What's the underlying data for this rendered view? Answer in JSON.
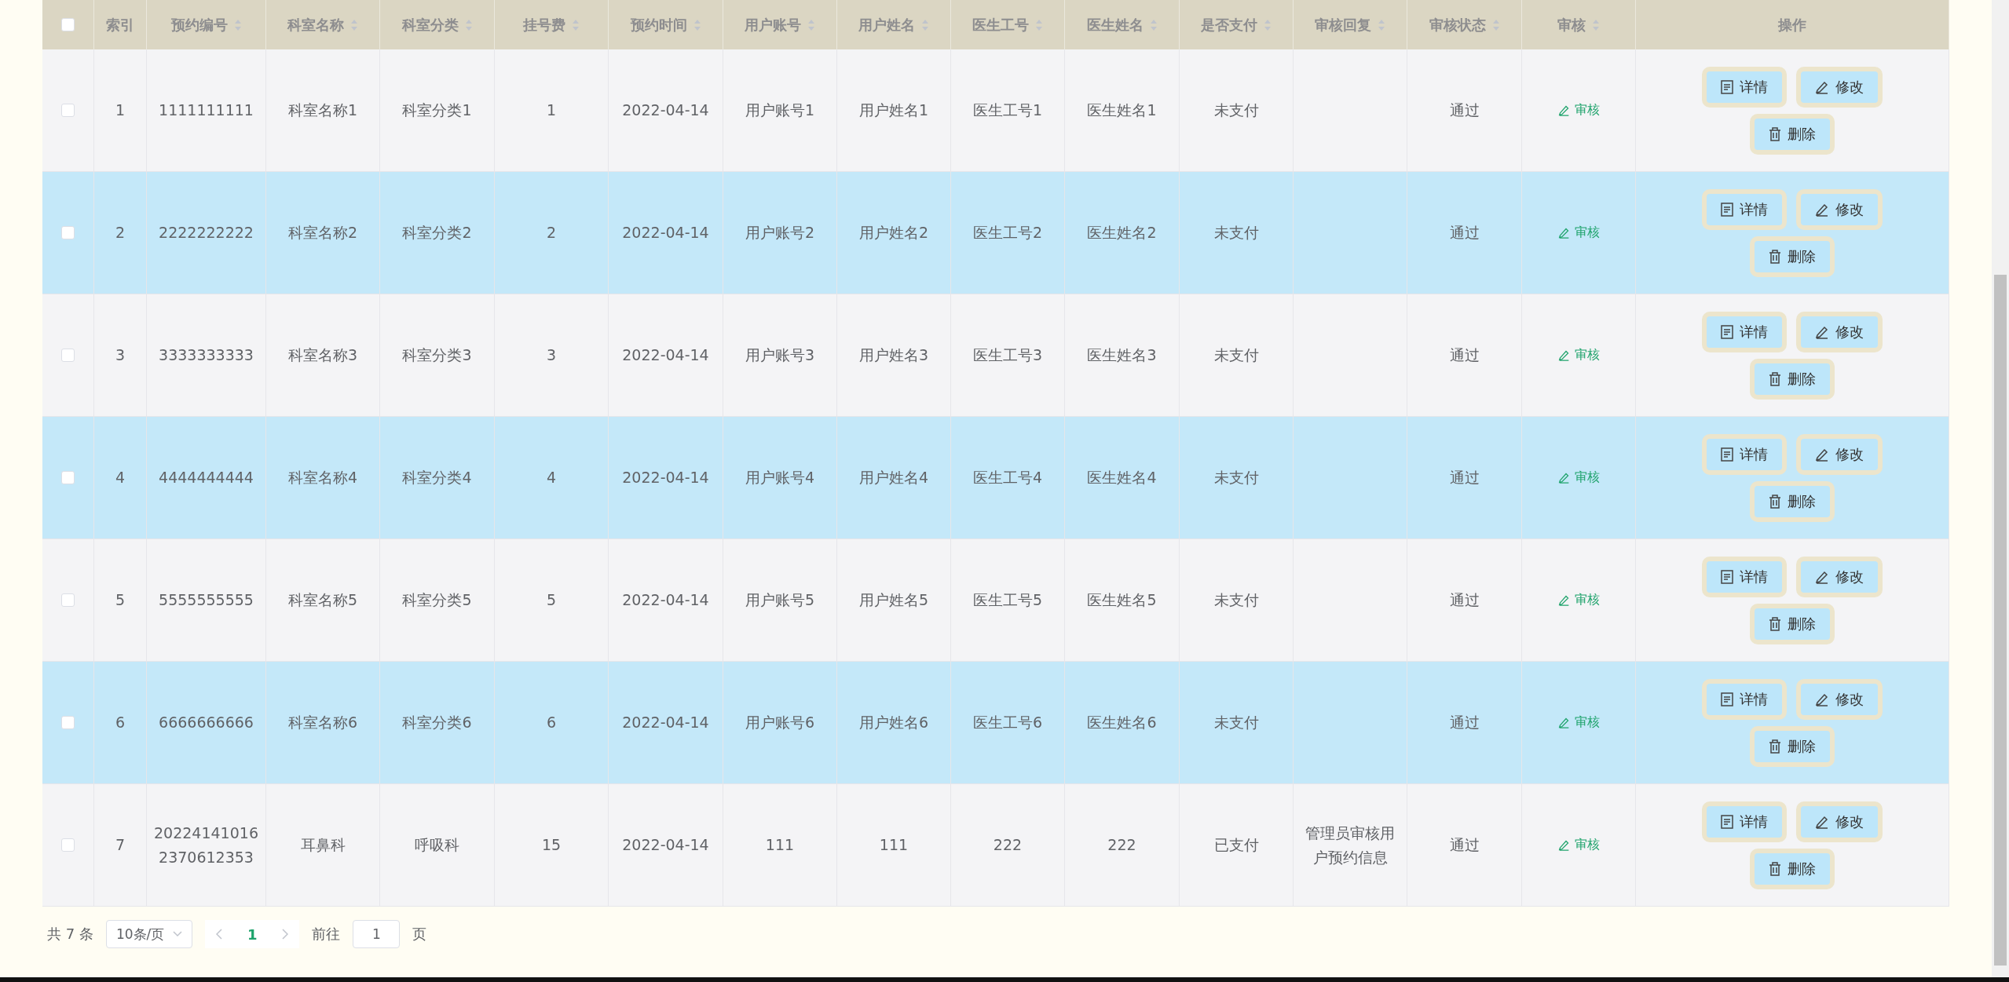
{
  "table": {
    "select_all": {
      "checked": false
    },
    "columns": [
      {
        "label": "索引",
        "sortable": false
      },
      {
        "label": "预约编号",
        "sortable": true
      },
      {
        "label": "科室名称",
        "sortable": true
      },
      {
        "label": "科室分类",
        "sortable": true
      },
      {
        "label": "挂号费",
        "sortable": true
      },
      {
        "label": "预约时间",
        "sortable": true
      },
      {
        "label": "用户账号",
        "sortable": true
      },
      {
        "label": "用户姓名",
        "sortable": true
      },
      {
        "label": "医生工号",
        "sortable": true
      },
      {
        "label": "医生姓名",
        "sortable": true
      },
      {
        "label": "是否支付",
        "sortable": true
      },
      {
        "label": "审核回复",
        "sortable": true
      },
      {
        "label": "审核状态",
        "sortable": true
      },
      {
        "label": "审核",
        "sortable": true
      },
      {
        "label": "操作",
        "sortable": false
      }
    ],
    "rows": [
      {
        "checked": false,
        "cells": [
          "1",
          "1111111111",
          "科室名称1",
          "科室分类1",
          "1",
          "2022-04-14",
          "用户账号1",
          "用户姓名1",
          "医生工号1",
          "医生姓名1",
          "未支付",
          "",
          "通过"
        ],
        "review_link": "审核",
        "actions": [
          "详情",
          "修改",
          "删除"
        ]
      },
      {
        "checked": false,
        "cells": [
          "2",
          "2222222222",
          "科室名称2",
          "科室分类2",
          "2",
          "2022-04-14",
          "用户账号2",
          "用户姓名2",
          "医生工号2",
          "医生姓名2",
          "未支付",
          "",
          "通过"
        ],
        "review_link": "审核",
        "actions": [
          "详情",
          "修改",
          "删除"
        ]
      },
      {
        "checked": false,
        "cells": [
          "3",
          "3333333333",
          "科室名称3",
          "科室分类3",
          "3",
          "2022-04-14",
          "用户账号3",
          "用户姓名3",
          "医生工号3",
          "医生姓名3",
          "未支付",
          "",
          "通过"
        ],
        "review_link": "审核",
        "actions": [
          "详情",
          "修改",
          "删除"
        ]
      },
      {
        "checked": false,
        "cells": [
          "4",
          "4444444444",
          "科室名称4",
          "科室分类4",
          "4",
          "2022-04-14",
          "用户账号4",
          "用户姓名4",
          "医生工号4",
          "医生姓名4",
          "未支付",
          "",
          "通过"
        ],
        "review_link": "审核",
        "actions": [
          "详情",
          "修改",
          "删除"
        ]
      },
      {
        "checked": false,
        "cells": [
          "5",
          "5555555555",
          "科室名称5",
          "科室分类5",
          "5",
          "2022-04-14",
          "用户账号5",
          "用户姓名5",
          "医生工号5",
          "医生姓名5",
          "未支付",
          "",
          "通过"
        ],
        "review_link": "审核",
        "actions": [
          "详情",
          "修改",
          "删除"
        ]
      },
      {
        "checked": false,
        "cells": [
          "6",
          "6666666666",
          "科室名称6",
          "科室分类6",
          "6",
          "2022-04-14",
          "用户账号6",
          "用户姓名6",
          "医生工号6",
          "医生姓名6",
          "未支付",
          "",
          "通过"
        ],
        "review_link": "审核",
        "actions": [
          "详情",
          "修改",
          "删除"
        ]
      },
      {
        "checked": false,
        "cells": [
          "7",
          "202241410162370612353",
          "耳鼻科",
          "呼吸科",
          "15",
          "2022-04-14",
          "111",
          "111",
          "222",
          "222",
          "已支付",
          "管理员审核用户预约信息",
          "通过"
        ],
        "review_link": "审核",
        "actions": [
          "详情",
          "修改",
          "删除"
        ]
      }
    ]
  },
  "pagination": {
    "total": "共 7 条",
    "page_size": "10条/页",
    "current_page": "1",
    "goto_label": "前往",
    "goto_value": "1",
    "goto_suffix": "页"
  }
}
